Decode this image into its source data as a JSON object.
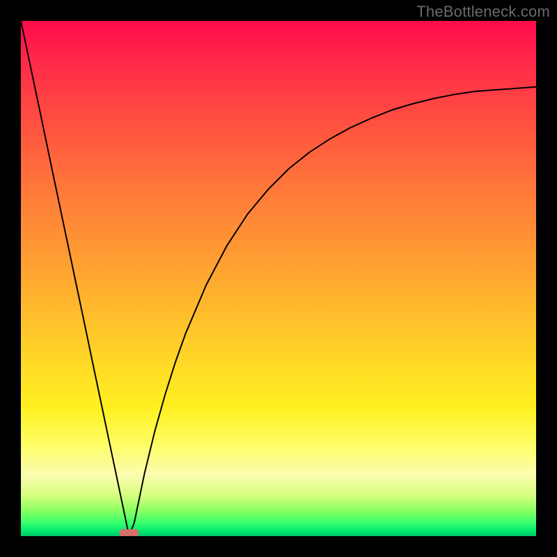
{
  "watermark": "TheBottleneck.com",
  "colors": {
    "frame_background": "#000000",
    "curve_stroke": "#000000",
    "marker_fill": "#d6706d",
    "gradient_top": "#ff0b4d",
    "gradient_bottom": "#00c968"
  },
  "chart_data": {
    "type": "line",
    "title": "",
    "xlabel": "",
    "ylabel": "",
    "xlim": [
      0,
      1
    ],
    "ylim": [
      0,
      1
    ],
    "legend": false,
    "grid": false,
    "description": "V-shaped bottleneck curve: left branch is a steep straight line from (0, 1.0) down to a minimum near x≈0.21, right branch climbs concavely toward (1, ≈0.87). Background is a vertical red→orange→yellow→green gradient; a small rounded pink marker sits at the minimum.",
    "x": [
      0.0,
      0.02,
      0.04,
      0.06,
      0.08,
      0.1,
      0.12,
      0.14,
      0.16,
      0.18,
      0.2,
      0.21,
      0.22,
      0.24,
      0.26,
      0.28,
      0.3,
      0.32,
      0.36,
      0.4,
      0.44,
      0.48,
      0.52,
      0.56,
      0.6,
      0.64,
      0.68,
      0.72,
      0.76,
      0.8,
      0.84,
      0.88,
      0.92,
      0.96,
      1.0
    ],
    "y": [
      1.0,
      0.905,
      0.81,
      0.714,
      0.619,
      0.524,
      0.429,
      0.333,
      0.238,
      0.143,
      0.048,
      0.0,
      0.026,
      0.122,
      0.204,
      0.275,
      0.338,
      0.394,
      0.488,
      0.564,
      0.625,
      0.673,
      0.713,
      0.745,
      0.771,
      0.793,
      0.811,
      0.827,
      0.839,
      0.849,
      0.857,
      0.863,
      0.866,
      0.869,
      0.872
    ],
    "minimum": {
      "x": 0.21,
      "y": 0.0
    }
  }
}
